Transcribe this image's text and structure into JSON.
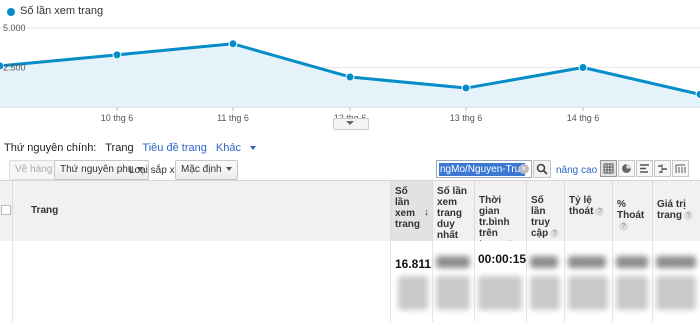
{
  "legend": {
    "label": "Số lần xem trang",
    "color": "#058dc7"
  },
  "chart_data": {
    "type": "area",
    "series": [
      {
        "name": "Số lần xem trang",
        "values": [
          2600,
          3300,
          4000,
          1900,
          1200,
          2500,
          800
        ]
      }
    ],
    "x_ticks": [
      "10 thg 6",
      "11 thg 6",
      "12 thg 6",
      "13 thg 6",
      "14 thg 6"
    ],
    "y_ticks": [
      "5.000",
      "2.500"
    ],
    "ylim": [
      0,
      5000
    ],
    "line_color": "#058dc7",
    "fill_color": "#e6f2fa",
    "grid": true
  },
  "dimension_bar": {
    "label": "Thứ nguyên chính:",
    "current": "Trang",
    "links": [
      "Tiêu đề trang",
      "Khác"
    ]
  },
  "toolbar": {
    "secondary_dimension_button": "Vẽ hàng",
    "secondary_dimension": "Thứ nguyên phụ",
    "sort_type_label": "Loại sắp xếp:",
    "sort_type_value": "Mặc định",
    "search_value": "ngMo/Nguyen-Truc-Lu",
    "advanced": "nâng cao"
  },
  "table": {
    "headers": {
      "page": "Trang",
      "pageviews": "Số lần xem trang",
      "unique_pageviews": "Số lần xem trang duy nhất",
      "avg_time": "Thời gian tr.bình trên trang",
      "entrances": "Số lần truy cập",
      "exit_rate_pre": "Tỷ lệ thoát",
      "exit_pct": "% Thoát",
      "page_value": "Giá trị trang"
    },
    "row": {
      "pageviews": "16.811",
      "avg_time": "00:00:15"
    }
  }
}
